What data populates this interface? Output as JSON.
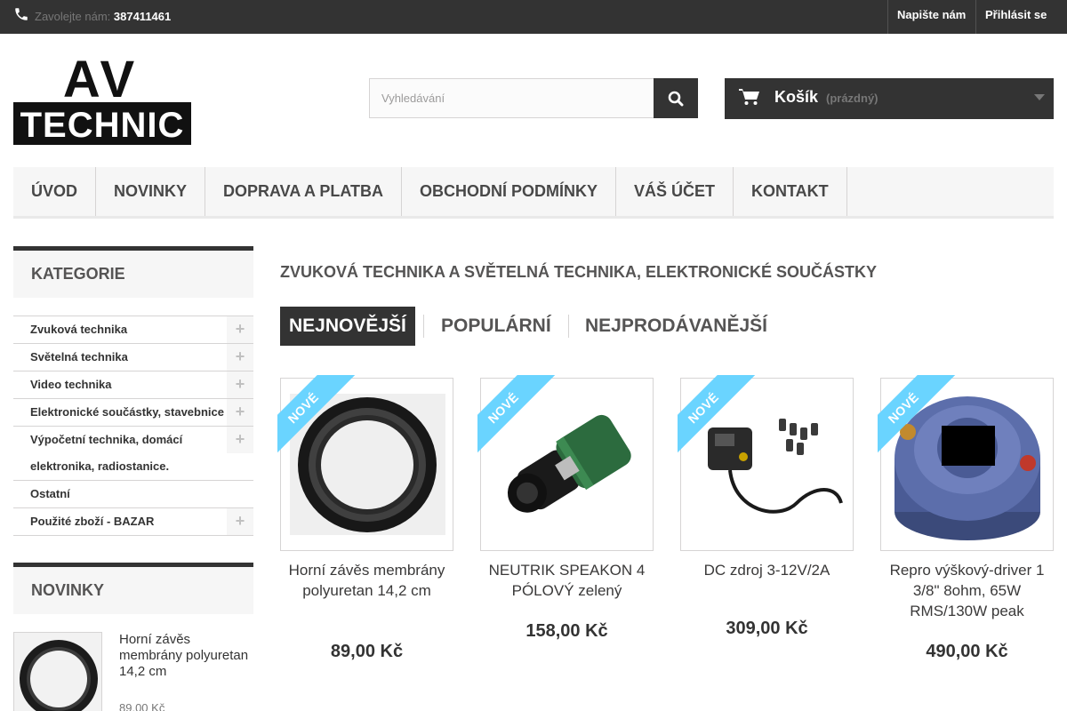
{
  "topbar": {
    "call_label": "Zavolejte nám:",
    "phone": "387411461",
    "contact_link": "Napište nám",
    "login_link": "Přihlásit se"
  },
  "logo": {
    "line1": "AV",
    "line2": "TECHNIC"
  },
  "search": {
    "placeholder": "Vyhledávání"
  },
  "cart": {
    "title": "Košík",
    "status": "(prázdný)"
  },
  "menu": {
    "items": [
      {
        "label": "ÚVOD"
      },
      {
        "label": "NOVINKY"
      },
      {
        "label": "DOPRAVA A PLATBA"
      },
      {
        "label": "OBCHODNÍ PODMÍNKY"
      },
      {
        "label": "VÁŠ ÚČET"
      },
      {
        "label": "KONTAKT"
      }
    ]
  },
  "sidebar": {
    "categories_title": "KATEGORIE",
    "categories": [
      {
        "label": "Zvuková technika",
        "expandable": true
      },
      {
        "label": "Světelná technika",
        "expandable": true
      },
      {
        "label": "Video technika",
        "expandable": true
      },
      {
        "label": "Elektronické součástky, stavebnice",
        "expandable": true
      },
      {
        "label": "Výpočetní technika, domácí elektronika, radiostanice.",
        "expandable": true
      },
      {
        "label": "Ostatní",
        "expandable": false
      },
      {
        "label": "Použité zboží - BAZAR",
        "expandable": true
      }
    ],
    "new_title": "NOVINKY",
    "new_product": {
      "name": "Horní závěs membrány polyuretan 14,2 cm",
      "price": "89,00 Kč"
    }
  },
  "main": {
    "heading": "ZVUKOVÁ TECHNIKA A SVĚTELNÁ TECHNIKA, ELEKTRONICKÉ SOUČÁSTKY",
    "tabs": [
      {
        "label": "NEJNOVĚJŠÍ",
        "active": true
      },
      {
        "label": "POPULÁRNÍ",
        "active": false
      },
      {
        "label": "NEJPRODÁVANĚJŠÍ",
        "active": false
      }
    ],
    "products": [
      {
        "badge": "NOVÉ",
        "name": "Horní závěs membrány polyuretan 14,2 cm",
        "price": "89,00 Kč"
      },
      {
        "badge": "NOVÉ",
        "name": "NEUTRIK SPEAKON 4 PÓLOVÝ zelený",
        "price": "158,00 Kč"
      },
      {
        "badge": "NOVÉ",
        "name": "DC zdroj 3-12V/2A",
        "price": "309,00 Kč"
      },
      {
        "badge": "NOVÉ",
        "name": "Repro výškový-driver 1 3/8\" 8ohm, 65W RMS/130W peak",
        "price": "490,00 Kč"
      }
    ]
  },
  "colors": {
    "dark": "#333333",
    "ribbon": "#6ad4ff",
    "light_bg": "#f6f6f6",
    "border": "#d6d4d4"
  }
}
